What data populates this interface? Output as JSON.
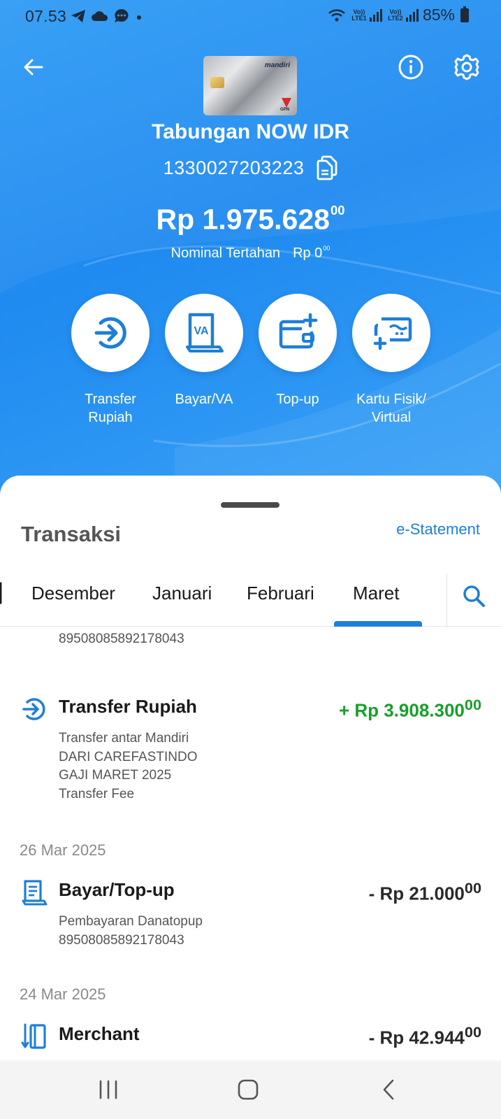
{
  "status_bar": {
    "time": "07.53",
    "sim1_label": "Vo)) LTE1",
    "sim2_label": "Vo)) LTE2",
    "battery": "85%"
  },
  "header": {
    "back_icon": "arrow-left-icon",
    "info_icon": "info-icon",
    "settings_icon": "gear-icon",
    "card_brand": "mandiri",
    "card_network": "GPN"
  },
  "account": {
    "name": "Tabungan NOW IDR",
    "number": "1330027203223",
    "balance_main": "Rp 1.975.628",
    "balance_cents": "00",
    "held_label": "Nominal Tertahan",
    "held_main": "Rp 0",
    "held_cents": "00"
  },
  "actions": [
    {
      "label": "Transfer\nRupiah",
      "icon": "transfer-icon"
    },
    {
      "label": "Bayar/VA",
      "icon": "va-bill-icon"
    },
    {
      "label": "Top-up",
      "icon": "wallet-add-icon"
    },
    {
      "label": "Kartu Fisik/\nVirtual",
      "icon": "card-add-icon"
    }
  ],
  "sheet": {
    "title": "Transaksi",
    "estatement": "e-Statement",
    "tabs": [
      "Desember",
      "Januari",
      "Februari",
      "Maret"
    ],
    "active_tab": "Maret",
    "search_icon": "search-icon"
  },
  "transactions": {
    "cut_off_line": "89508085892178043",
    "items": [
      {
        "title": "Transfer Rupiah",
        "amount_main": "+ Rp 3.908.300",
        "amount_cents": "00",
        "direction": "credit",
        "icon": "transfer-icon",
        "description": "Transfer antar Mandiri\nDARI CAREFASTINDO\nGAJI MARET 2025\nTransfer Fee"
      },
      {
        "date": "26 Mar 2025",
        "title": "Bayar/Top-up",
        "amount_main": "- Rp 21.000",
        "amount_cents": "00",
        "direction": "debit",
        "icon": "receipt-icon",
        "description": "Pembayaran Danatopup\n89508085892178043"
      },
      {
        "date": "24 Mar 2025",
        "title": "Merchant",
        "amount_main": "- Rp 42.944",
        "amount_cents": "00",
        "direction": "debit",
        "icon": "merchant-icon",
        "description": ""
      }
    ]
  },
  "colors": {
    "brand_blue": "#1e7fd6",
    "hero_blue": "#2f9bf5",
    "credit_green": "#16a02a"
  },
  "navbar": {
    "recent_icon": "recent-apps-icon",
    "home_icon": "home-icon",
    "back_icon": "back-chevron-icon"
  }
}
